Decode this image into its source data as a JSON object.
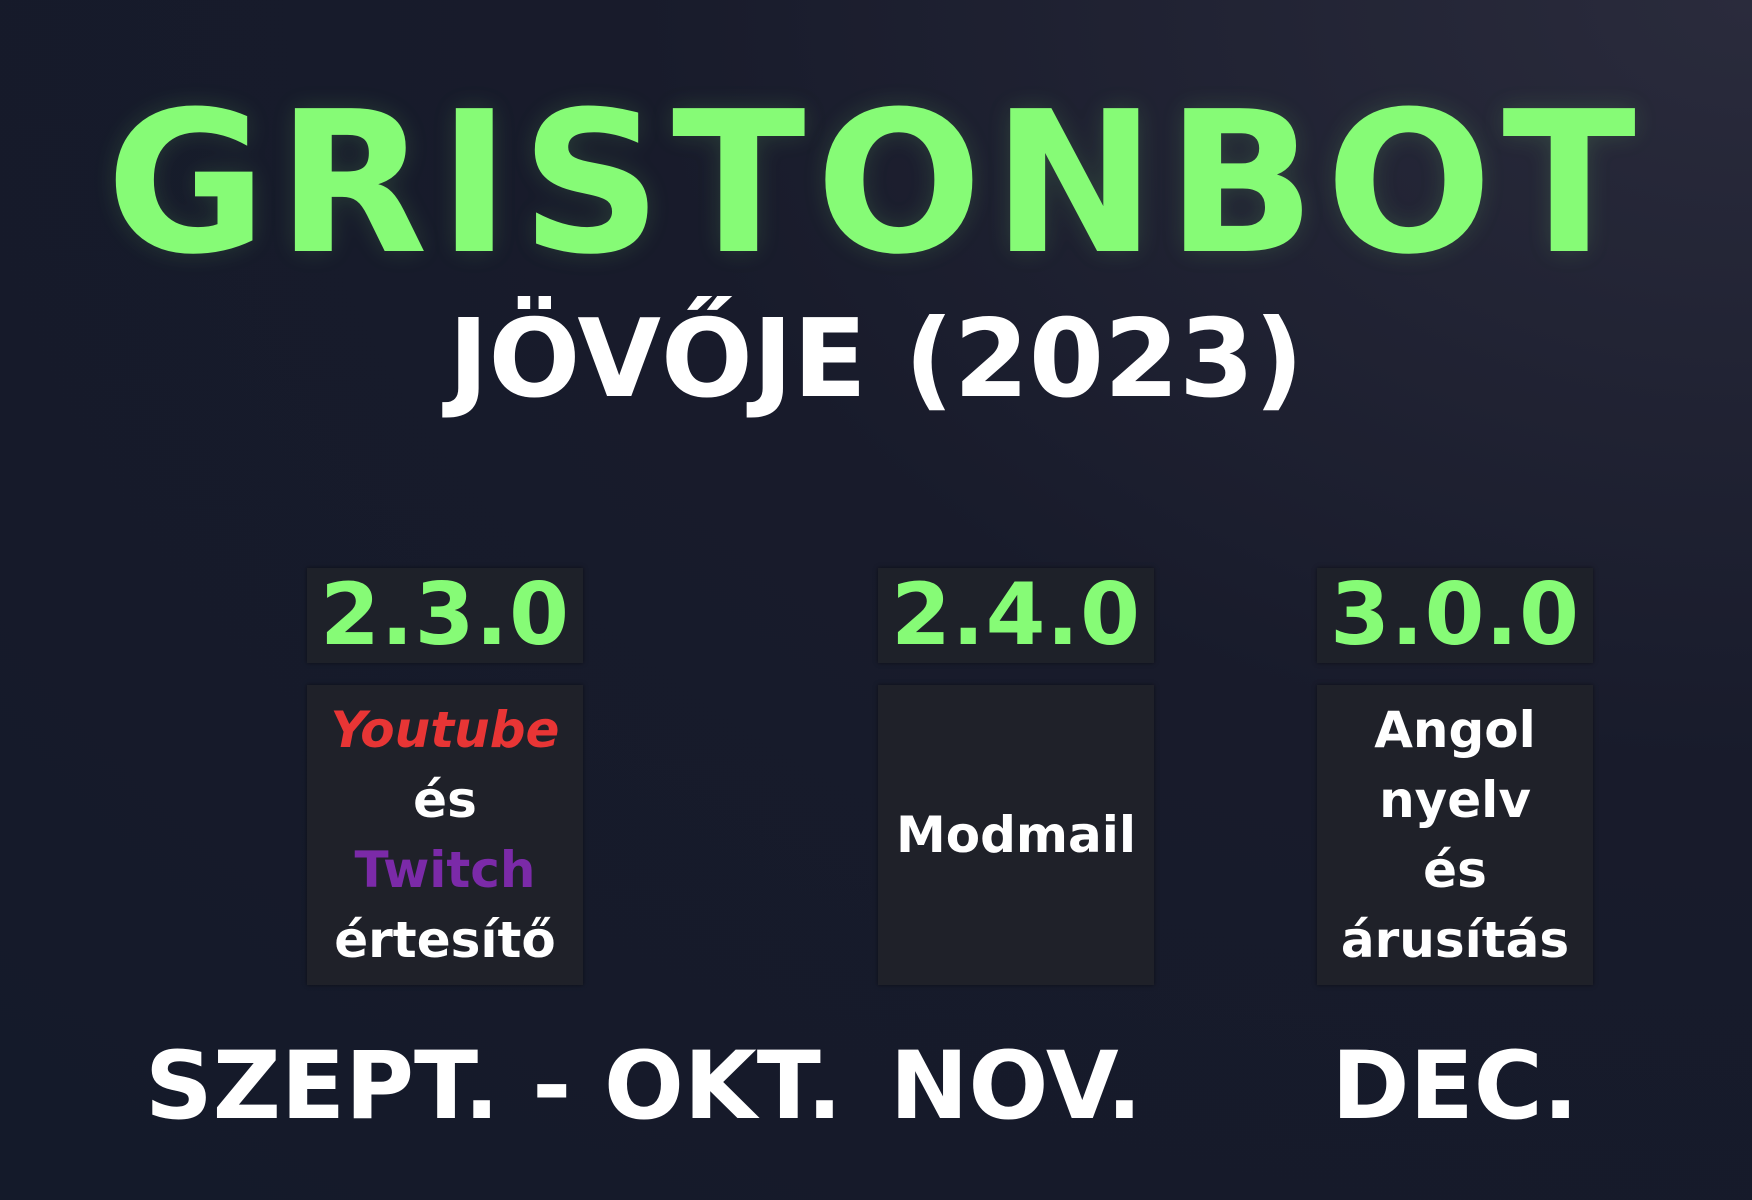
{
  "title": "GRISTONBOT",
  "subtitle": "JÖVŐJE (2023)",
  "colors": {
    "accent": "#86fb76",
    "youtube": "#e83535",
    "twitch": "#7b2aa8",
    "text": "#ffffff",
    "background": "#181b2b",
    "card": "#1f2129"
  },
  "releases": [
    {
      "version": "2.3.0",
      "feature": {
        "youtube": "Youtube",
        "and": "és",
        "twitch": "Twitch",
        "notifier": "értesítő"
      },
      "month": "SZEPT. - OKT."
    },
    {
      "version": "2.4.0",
      "feature": {
        "line1": "Modmail"
      },
      "month": "NOV."
    },
    {
      "version": "3.0.0",
      "feature": {
        "line1": "Angol",
        "line2": "nyelv",
        "line3": "és",
        "line4": "árusítás"
      },
      "month": "DEC."
    }
  ]
}
